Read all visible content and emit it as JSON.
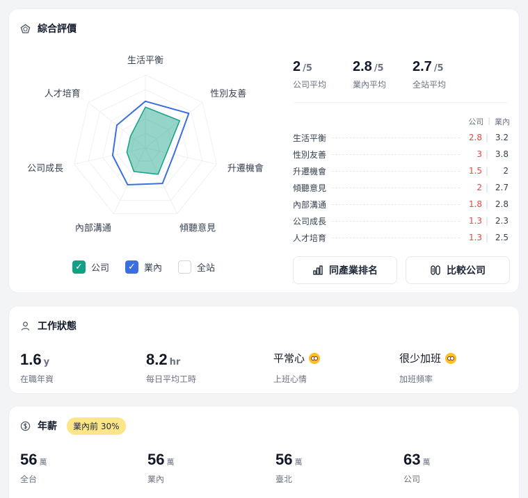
{
  "rating": {
    "title": "綜合評價",
    "legend": {
      "company": "公司",
      "industry": "業內",
      "site": "全站"
    },
    "summary": [
      {
        "num": "2",
        "den": "/5",
        "label": "公司平均"
      },
      {
        "num": "2.8",
        "den": "/5",
        "label": "業內平均"
      },
      {
        "num": "2.7",
        "den": "/5",
        "label": "全站平均"
      }
    ],
    "compare_header": {
      "company": "公司",
      "sep": "|",
      "industry": "業內"
    },
    "rows": [
      {
        "label": "生活平衡",
        "company": "2.8",
        "sep": "|",
        "industry": "3.2"
      },
      {
        "label": "性別友善",
        "company": "3",
        "sep": "|",
        "industry": "3.8"
      },
      {
        "label": "升遷機會",
        "company": "1.5",
        "sep": "|",
        "industry": "2"
      },
      {
        "label": "傾聽意見",
        "company": "2",
        "sep": "|",
        "industry": "2.7"
      },
      {
        "label": "內部溝通",
        "company": "1.8",
        "sep": "|",
        "industry": "2.8"
      },
      {
        "label": "公司成長",
        "company": "1.3",
        "sep": "|",
        "industry": "2.3"
      },
      {
        "label": "人才培育",
        "company": "1.3",
        "sep": "|",
        "industry": "2.5"
      }
    ],
    "buttons": {
      "rank": "同產業排名",
      "compare": "比較公司"
    }
  },
  "work": {
    "title": "工作狀態",
    "stats": [
      {
        "num": "1.6",
        "unit": "y",
        "label": "在職年資"
      },
      {
        "num": "8.2",
        "unit": "hr",
        "label": "每日平均工時"
      },
      {
        "text": "平常心",
        "label": "上班心情"
      },
      {
        "text": "很少加班",
        "label": "加班頻率"
      }
    ]
  },
  "salary": {
    "title": "年薪",
    "badge": "業內前 30%",
    "items": [
      {
        "num": "56",
        "unit": "萬",
        "label": "全台"
      },
      {
        "num": "56",
        "unit": "萬",
        "label": "業內"
      },
      {
        "num": "56",
        "unit": "萬",
        "label": "臺北"
      },
      {
        "num": "63",
        "unit": "萬",
        "label": "公司"
      }
    ]
  },
  "colors": {
    "company": "#14a085",
    "industry": "#3b6fe0",
    "accent_red": "#ef4444",
    "badge": "#fde68a"
  },
  "icons": [
    "pentagon-icon",
    "check-icon",
    "bar-chart-icon",
    "compare-icon",
    "person-icon",
    "dollar-icon",
    "face-emoji-icon"
  ],
  "chart_data": {
    "type": "radar",
    "axes": [
      "生活平衡",
      "性別友善",
      "升遷機會",
      "傾聽意見",
      "內部溝通",
      "公司成長",
      "人才培育"
    ],
    "scale_max": 5,
    "series": [
      {
        "name": "公司",
        "values": [
          2.8,
          3,
          1.5,
          2,
          1.8,
          1.3,
          1.3
        ]
      },
      {
        "name": "業內",
        "values": [
          3.2,
          3.8,
          2,
          2.7,
          2.8,
          2.3,
          2.5
        ]
      }
    ],
    "legend_position": "bottom"
  }
}
